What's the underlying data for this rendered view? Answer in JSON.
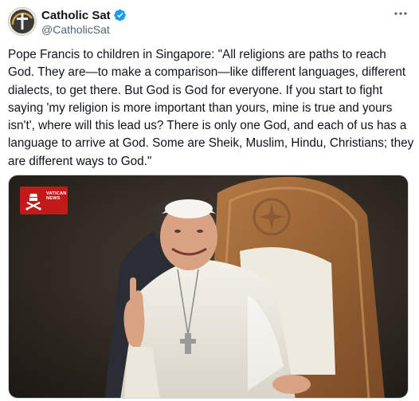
{
  "author": {
    "display_name": "Catholic Sat",
    "handle": "@CatholicSat",
    "avatar_icon": "catholic-sat-logo",
    "verified_icon": "verified-badge-icon",
    "verified_color": "#1d9bf0"
  },
  "menu": {
    "more_icon": "more-horizontal-icon"
  },
  "tweet": {
    "text": "Pope Francis to children in Singapore: \"All religions are paths to reach God. They are—to make a comparison—like different languages, different dialects, to get there. But God is God for everyone. If you start to fight saying 'my religion is more important than yours, mine is true and yours isn't', where will this lead us? There is only one God, and each of us has a language to arrive at God. Some are Sheik, Muslim, Hindu, Christians; they are different ways to God.\""
  },
  "media": {
    "watermark": {
      "line1": "VATICAN",
      "line2": "NEWS",
      "color": "#c21a1a"
    }
  }
}
